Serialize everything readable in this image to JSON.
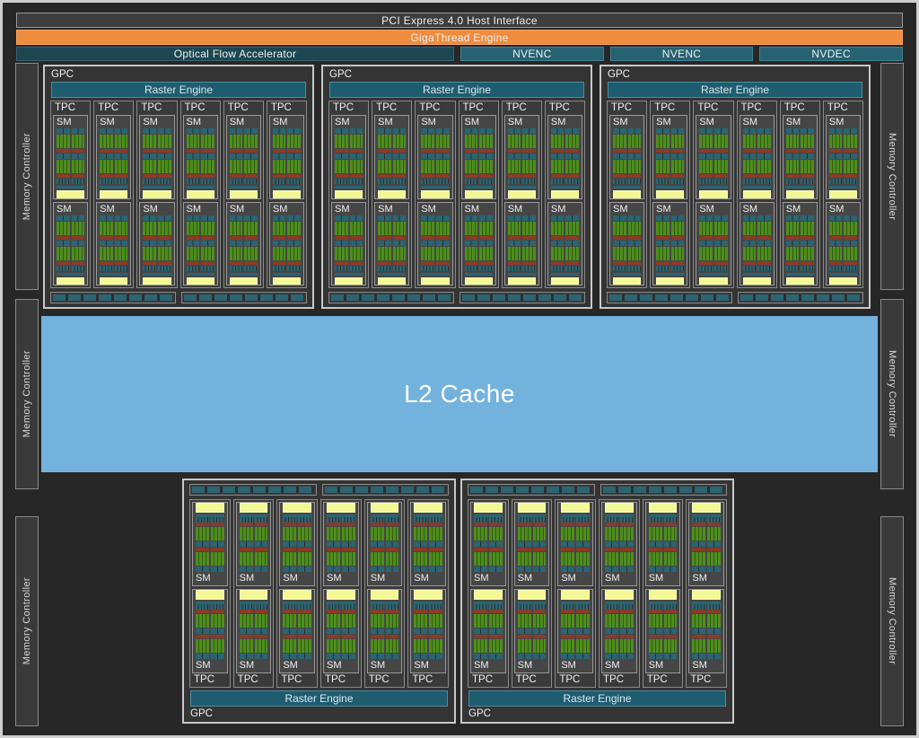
{
  "header": {
    "pci": "PCI Express 4.0 Host Interface",
    "gigathread": "GigaThread Engine",
    "optical_flow": "Optical Flow Accelerator",
    "encoders": [
      "NVENC",
      "NVENC",
      "NVDEC"
    ]
  },
  "labels": {
    "gpc": "GPC",
    "raster": "Raster Engine",
    "tpc": "TPC",
    "sm": "SM",
    "l2": "L2 Cache",
    "memory_controller": "Memory Controller"
  },
  "structure": {
    "top_gpcs": 3,
    "bottom_gpcs": 2,
    "tpcs_per_gpc": 6,
    "sms_per_tpc": 2,
    "memory_controllers_per_side": 3
  },
  "colors": {
    "bg": "#272727",
    "frame_border": "#cfcfcf",
    "panel": "#3d3d3d",
    "panel_border": "#9a9a9a",
    "orange": "#ef8c3d",
    "orange_hl": "#f4a361",
    "teal_dark": "#1c4752",
    "teal_dark_hl": "#3a616c",
    "teal_bar": "#266271",
    "teal_bar_hl": "#45808f",
    "raster": "#1e5d70",
    "raster_hl": "#4f8b9e",
    "teal_unit": "#2a6573",
    "green": "#4f8d1e",
    "green_dark": "#2f5d11",
    "red": "#8c3a28",
    "yellow": "#f3f795",
    "yellow_hl": "#fbfdbb",
    "l2_blue": "#74b2de",
    "gpc_bg": "#343434",
    "tpc_bg": "#3a3a3a",
    "sm_bg": "#464646",
    "mc_bg": "#3a3a3a",
    "border_light": "#c8c8c8",
    "border_mid": "#8a8a8a",
    "border_mid2": "#9a9a9a",
    "gap_dark": "#2e2e2e",
    "text": "#f0f0f0"
  }
}
